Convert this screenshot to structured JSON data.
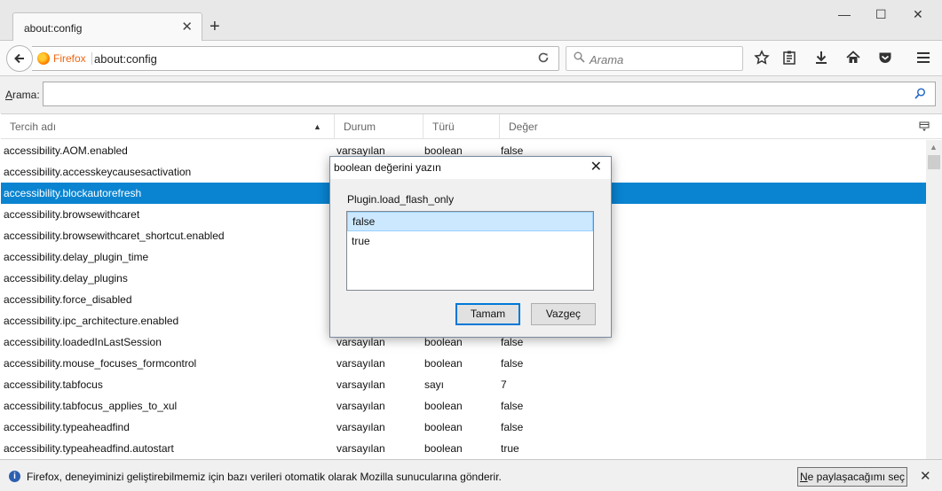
{
  "window": {
    "tab_title": "about:config",
    "tab_close_glyph": "✕",
    "new_tab_glyph": "+",
    "min_glyph": "—",
    "max_glyph": "☐",
    "close_glyph": "✕"
  },
  "navbar": {
    "identity_label": "Firefox",
    "url": "about:config",
    "search_placeholder": "Arama",
    "icons": [
      "back-icon",
      "reload-icon",
      "bookmark-star-icon",
      "reading-list-icon",
      "download-icon",
      "home-icon",
      "pocket-icon",
      "menu-icon"
    ]
  },
  "filter": {
    "label_underlined": "A",
    "label_rest": "rama:",
    "value": ""
  },
  "table": {
    "headers": {
      "name": "Tercih adı",
      "status": "Durum",
      "type": "Türü",
      "value": "Değer"
    },
    "rows": [
      {
        "name": "accessibility.AOM.enabled",
        "status": "varsayılan",
        "type": "boolean",
        "value": "false"
      },
      {
        "name": "accessibility.accesskeycausesactivation",
        "status": "",
        "type": "",
        "value": ""
      },
      {
        "name": "accessibility.blockautorefresh",
        "status": "",
        "type": "",
        "value": "",
        "selected": true
      },
      {
        "name": "accessibility.browsewithcaret",
        "status": "",
        "type": "",
        "value": ""
      },
      {
        "name": "accessibility.browsewithcaret_shortcut.enabled",
        "status": "",
        "type": "",
        "value": ""
      },
      {
        "name": "accessibility.delay_plugin_time",
        "status": "",
        "type": "",
        "value": ""
      },
      {
        "name": "accessibility.delay_plugins",
        "status": "",
        "type": "",
        "value": ""
      },
      {
        "name": "accessibility.force_disabled",
        "status": "",
        "type": "",
        "value": ""
      },
      {
        "name": "accessibility.ipc_architecture.enabled",
        "status": "",
        "type": "",
        "value": ""
      },
      {
        "name": "accessibility.loadedInLastSession",
        "status": "varsayılan",
        "type": "boolean",
        "value": "false"
      },
      {
        "name": "accessibility.mouse_focuses_formcontrol",
        "status": "varsayılan",
        "type": "boolean",
        "value": "false"
      },
      {
        "name": "accessibility.tabfocus",
        "status": "varsayılan",
        "type": "sayı",
        "value": "7"
      },
      {
        "name": "accessibility.tabfocus_applies_to_xul",
        "status": "varsayılan",
        "type": "boolean",
        "value": "false"
      },
      {
        "name": "accessibility.typeaheadfind",
        "status": "varsayılan",
        "type": "boolean",
        "value": "false"
      },
      {
        "name": "accessibility.typeaheadfind.autostart",
        "status": "varsayılan",
        "type": "boolean",
        "value": "true"
      }
    ]
  },
  "dialog": {
    "title": "boolean değerini yazın",
    "prompt": "Plugin.load_flash_only",
    "options": [
      {
        "label": "false",
        "selected": true
      },
      {
        "label": "true",
        "selected": false
      }
    ],
    "ok_label": "Tamam",
    "cancel_label": "Vazgeç"
  },
  "notification": {
    "text": "Firefox, deneyiminizi geliştirebilmemiz için bazı verileri otomatik olarak Mozilla sunucularına gönderir.",
    "button_underlined": "N",
    "button_rest": "e paylaşacağımı seç",
    "close_glyph": "✕"
  },
  "colors": {
    "selection": "#0a84d1",
    "firefox_orange": "#f0650f",
    "dialog_default_border": "#0078d7"
  }
}
